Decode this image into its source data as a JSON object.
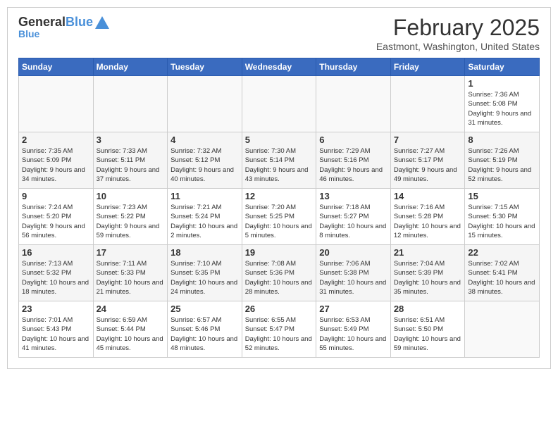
{
  "header": {
    "logo_general": "General",
    "logo_blue": "Blue",
    "month_title": "February 2025",
    "location": "Eastmont, Washington, United States"
  },
  "days_of_week": [
    "Sunday",
    "Monday",
    "Tuesday",
    "Wednesday",
    "Thursday",
    "Friday",
    "Saturday"
  ],
  "weeks": [
    [
      {
        "num": "",
        "info": ""
      },
      {
        "num": "",
        "info": ""
      },
      {
        "num": "",
        "info": ""
      },
      {
        "num": "",
        "info": ""
      },
      {
        "num": "",
        "info": ""
      },
      {
        "num": "",
        "info": ""
      },
      {
        "num": "1",
        "info": "Sunrise: 7:36 AM\nSunset: 5:08 PM\nDaylight: 9 hours and 31 minutes."
      }
    ],
    [
      {
        "num": "2",
        "info": "Sunrise: 7:35 AM\nSunset: 5:09 PM\nDaylight: 9 hours and 34 minutes."
      },
      {
        "num": "3",
        "info": "Sunrise: 7:33 AM\nSunset: 5:11 PM\nDaylight: 9 hours and 37 minutes."
      },
      {
        "num": "4",
        "info": "Sunrise: 7:32 AM\nSunset: 5:12 PM\nDaylight: 9 hours and 40 minutes."
      },
      {
        "num": "5",
        "info": "Sunrise: 7:30 AM\nSunset: 5:14 PM\nDaylight: 9 hours and 43 minutes."
      },
      {
        "num": "6",
        "info": "Sunrise: 7:29 AM\nSunset: 5:16 PM\nDaylight: 9 hours and 46 minutes."
      },
      {
        "num": "7",
        "info": "Sunrise: 7:27 AM\nSunset: 5:17 PM\nDaylight: 9 hours and 49 minutes."
      },
      {
        "num": "8",
        "info": "Sunrise: 7:26 AM\nSunset: 5:19 PM\nDaylight: 9 hours and 52 minutes."
      }
    ],
    [
      {
        "num": "9",
        "info": "Sunrise: 7:24 AM\nSunset: 5:20 PM\nDaylight: 9 hours and 56 minutes."
      },
      {
        "num": "10",
        "info": "Sunrise: 7:23 AM\nSunset: 5:22 PM\nDaylight: 9 hours and 59 minutes."
      },
      {
        "num": "11",
        "info": "Sunrise: 7:21 AM\nSunset: 5:24 PM\nDaylight: 10 hours and 2 minutes."
      },
      {
        "num": "12",
        "info": "Sunrise: 7:20 AM\nSunset: 5:25 PM\nDaylight: 10 hours and 5 minutes."
      },
      {
        "num": "13",
        "info": "Sunrise: 7:18 AM\nSunset: 5:27 PM\nDaylight: 10 hours and 8 minutes."
      },
      {
        "num": "14",
        "info": "Sunrise: 7:16 AM\nSunset: 5:28 PM\nDaylight: 10 hours and 12 minutes."
      },
      {
        "num": "15",
        "info": "Sunrise: 7:15 AM\nSunset: 5:30 PM\nDaylight: 10 hours and 15 minutes."
      }
    ],
    [
      {
        "num": "16",
        "info": "Sunrise: 7:13 AM\nSunset: 5:32 PM\nDaylight: 10 hours and 18 minutes."
      },
      {
        "num": "17",
        "info": "Sunrise: 7:11 AM\nSunset: 5:33 PM\nDaylight: 10 hours and 21 minutes."
      },
      {
        "num": "18",
        "info": "Sunrise: 7:10 AM\nSunset: 5:35 PM\nDaylight: 10 hours and 24 minutes."
      },
      {
        "num": "19",
        "info": "Sunrise: 7:08 AM\nSunset: 5:36 PM\nDaylight: 10 hours and 28 minutes."
      },
      {
        "num": "20",
        "info": "Sunrise: 7:06 AM\nSunset: 5:38 PM\nDaylight: 10 hours and 31 minutes."
      },
      {
        "num": "21",
        "info": "Sunrise: 7:04 AM\nSunset: 5:39 PM\nDaylight: 10 hours and 35 minutes."
      },
      {
        "num": "22",
        "info": "Sunrise: 7:02 AM\nSunset: 5:41 PM\nDaylight: 10 hours and 38 minutes."
      }
    ],
    [
      {
        "num": "23",
        "info": "Sunrise: 7:01 AM\nSunset: 5:43 PM\nDaylight: 10 hours and 41 minutes."
      },
      {
        "num": "24",
        "info": "Sunrise: 6:59 AM\nSunset: 5:44 PM\nDaylight: 10 hours and 45 minutes."
      },
      {
        "num": "25",
        "info": "Sunrise: 6:57 AM\nSunset: 5:46 PM\nDaylight: 10 hours and 48 minutes."
      },
      {
        "num": "26",
        "info": "Sunrise: 6:55 AM\nSunset: 5:47 PM\nDaylight: 10 hours and 52 minutes."
      },
      {
        "num": "27",
        "info": "Sunrise: 6:53 AM\nSunset: 5:49 PM\nDaylight: 10 hours and 55 minutes."
      },
      {
        "num": "28",
        "info": "Sunrise: 6:51 AM\nSunset: 5:50 PM\nDaylight: 10 hours and 59 minutes."
      },
      {
        "num": "",
        "info": ""
      }
    ]
  ]
}
